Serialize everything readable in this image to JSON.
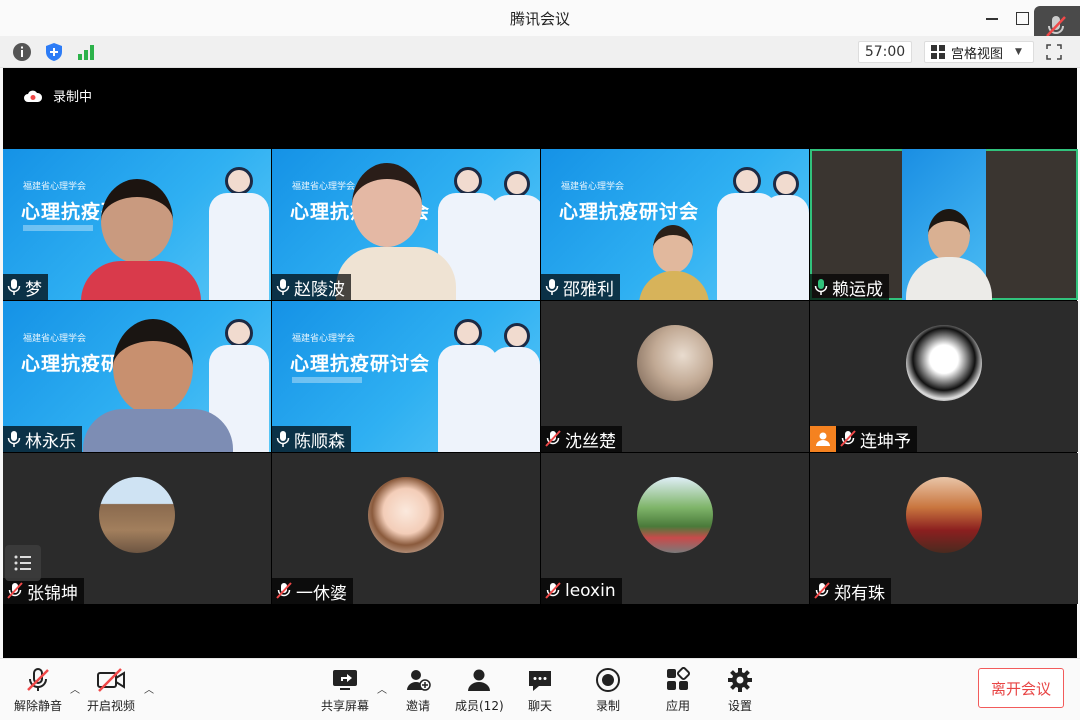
{
  "window": {
    "title": "腾讯会议"
  },
  "status_bar": {
    "timer": "57:00",
    "view_label": "宫格视图"
  },
  "recording": {
    "label": "录制中"
  },
  "poster_text": {
    "org": "福建省心理学会",
    "title": "心理抗疫研讨会"
  },
  "participants": [
    {
      "name": "梦"
    },
    {
      "name": "赵陵波"
    },
    {
      "name": "邵雅利"
    },
    {
      "name": "赖运成"
    },
    {
      "name": "林永乐"
    },
    {
      "name": "陈顺森"
    },
    {
      "name": "沈丝楚"
    },
    {
      "name": "连坤予"
    },
    {
      "name": "张锦坤"
    },
    {
      "name": "一休婆"
    },
    {
      "name": "leoxin"
    },
    {
      "name": "郑有珠"
    }
  ],
  "toolbar": {
    "unmute": "解除静音",
    "start_video": "开启视频",
    "share_screen": "共享屏幕",
    "invite": "邀请",
    "members": "成员(12)",
    "chat": "聊天",
    "record": "录制",
    "apps": "应用",
    "settings": "设置",
    "leave": "离开会议"
  },
  "colors": {
    "accent_green": "#31c27c",
    "leave_red": "#e84545",
    "poster_blue": "#1592e6"
  }
}
